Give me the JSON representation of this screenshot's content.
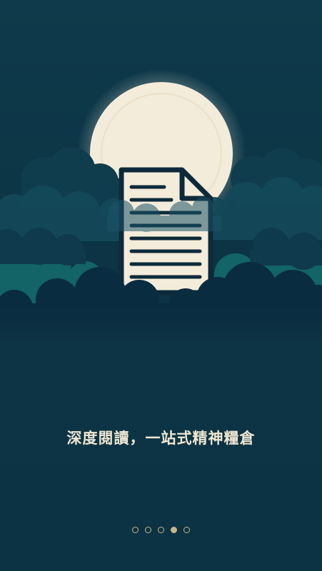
{
  "onboarding": {
    "tagline": "深度閱讀，一站式精神糧倉",
    "illustration": "moon-clouds-document",
    "icon": "document-icon",
    "pager": {
      "total": 5,
      "active_index": 3
    }
  },
  "colors": {
    "background": "#0d3445",
    "moon": "#f3ecdc",
    "document_stroke": "#0d2a3a",
    "tagline": "#efe6d2",
    "dot": "#c9b48c",
    "cloud_teal": "#126466"
  }
}
